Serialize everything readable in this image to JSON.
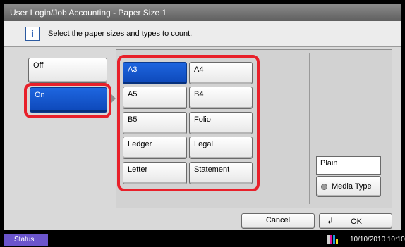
{
  "window": {
    "title": "User Login/Job Accounting - Paper Size 1"
  },
  "info": {
    "message": "Select the paper sizes and types to count."
  },
  "toggle": {
    "off_label": "Off",
    "on_label": "On"
  },
  "sizes": [
    "A3",
    "A4",
    "A5",
    "B4",
    "B5",
    "Folio",
    "Ledger",
    "Legal",
    "Letter",
    "Statement"
  ],
  "media": {
    "type_value": "Plain",
    "button_label": "Media Type"
  },
  "footer": {
    "cancel_label": "Cancel",
    "ok_label": "OK"
  },
  "statusbar": {
    "status_label": "Status",
    "datetime": "10/10/2010 10:10"
  }
}
